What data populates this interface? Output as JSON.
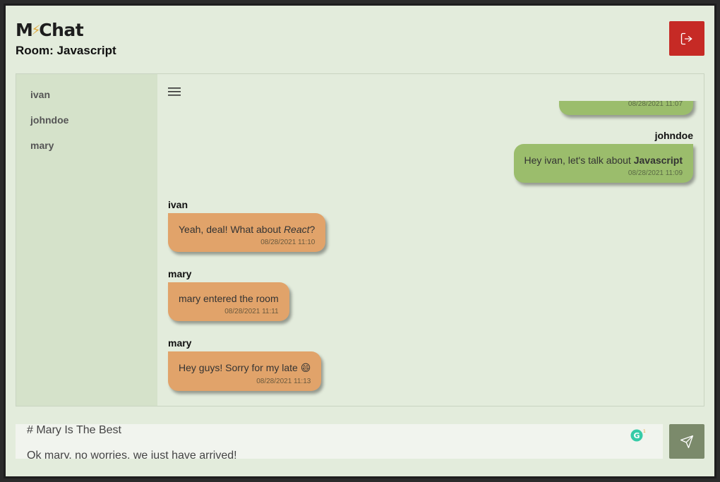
{
  "brand": {
    "logo_text_left": "M",
    "logo_text_right": "Chat"
  },
  "room": {
    "title": "Room: Javascript"
  },
  "colors": {
    "own_bubble": "#9bbd6c",
    "other_bubble": "#e1a36a",
    "logout_button": "#c62a25",
    "send_button": "#7b8a6b"
  },
  "sidebar": {
    "users": [
      {
        "name": "ivan"
      },
      {
        "name": "johndoe"
      },
      {
        "name": "mary"
      }
    ]
  },
  "messages": [
    {
      "sender": "",
      "own": true,
      "text": "",
      "time": "08/28/2021 11:07"
    },
    {
      "sender": "johndoe",
      "own": true,
      "text_plain": "Hey ivan, let's talk about ",
      "text_bold": "Javascript",
      "time": "08/28/2021 11:09"
    },
    {
      "sender": "ivan",
      "own": false,
      "text_plain": "Yeah, deal! What about ",
      "text_italic": "React",
      "text_after": "?",
      "time": "08/28/2021 11:10"
    },
    {
      "sender": "mary",
      "own": false,
      "text": "mary entered the room",
      "time": "08/28/2021 11:11"
    },
    {
      "sender": "mary",
      "own": false,
      "text": "Hey guys! Sorry for my late 😄",
      "time": "08/28/2021 11:13"
    }
  ],
  "composer": {
    "line1": "# Mary Is The Best",
    "line2": "Ok mary, no worries, we just have arrived!",
    "grammarly_count": "1"
  },
  "icons": {
    "logout": "logout-icon",
    "menu": "hamburger-menu-icon",
    "send": "send-icon",
    "grammarly": "grammarly-icon"
  }
}
